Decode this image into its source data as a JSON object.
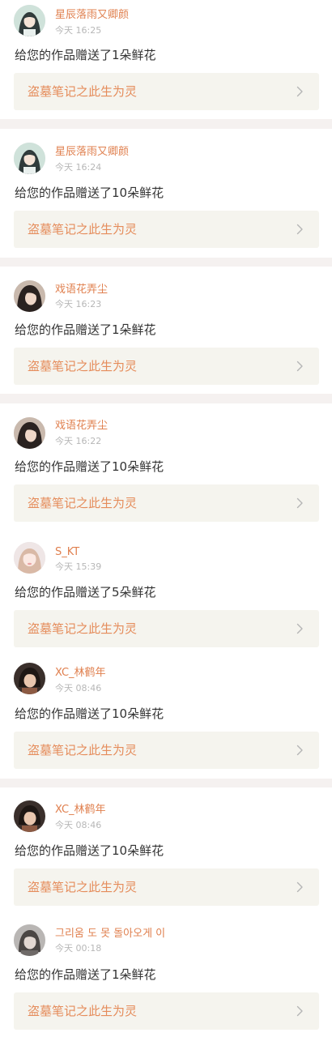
{
  "colors": {
    "name": "#e0804f",
    "time": "#b7b7b7",
    "message": "#333333",
    "card_bg": "#f5f4ee",
    "card_title": "#e58c5b",
    "separator": "#f5f1f0"
  },
  "items": [
    {
      "avatar": "avatar-anime-girl-icon",
      "name": "星辰落雨又卿颜",
      "time": "今天 16:25",
      "message": "给您的作品赠送了1朵鲜花",
      "work_title": "盗墓笔记之此生为灵",
      "arrow": "chevron-right-icon"
    },
    {
      "avatar": "avatar-anime-girl-icon",
      "name": "星辰落雨又卿颜",
      "time": "今天 16:24",
      "message": "给您的作品赠送了10朵鲜花",
      "work_title": "盗墓笔记之此生为灵",
      "arrow": "chevron-right-icon"
    },
    {
      "avatar": "avatar-dark-hair-icon",
      "name": "戏语花弄尘",
      "time": "今天 16:23",
      "message": "给您的作品赠送了1朵鲜花",
      "work_title": "盗墓笔记之此生为灵",
      "arrow": "chevron-right-icon"
    },
    {
      "avatar": "avatar-dark-hair-icon",
      "name": "戏语花弄尘",
      "time": "今天 16:22",
      "message": "给您的作品赠送了10朵鲜花",
      "work_title": "盗墓笔记之此生为灵",
      "arrow": "chevron-right-icon"
    },
    {
      "avatar": "avatar-light-girl-icon",
      "name": "S_KT",
      "time": "今天 15:39",
      "message": "给您的作品赠送了5朵鲜花",
      "work_title": "盗墓笔记之此生为灵",
      "arrow": "chevron-right-icon"
    },
    {
      "avatar": "avatar-boy-photo-icon",
      "name": "XC_林鹤年",
      "time": "今天 08:46",
      "message": "给您的作品赠送了10朵鲜花",
      "work_title": "盗墓笔记之此生为灵",
      "arrow": "chevron-right-icon"
    },
    {
      "avatar": "avatar-boy-photo-icon",
      "name": "XC_林鹤年",
      "time": "今天 08:46",
      "message": "给您的作品赠送了10朵鲜花",
      "work_title": "盗墓笔记之此生为灵",
      "arrow": "chevron-right-icon"
    },
    {
      "avatar": "avatar-gray-boy-icon",
      "name": "그리움 도 못 돌아오게 이",
      "time": "今天 00:18",
      "message": "给您的作品赠送了1朵鲜花",
      "work_title": "盗墓笔记之此生为灵",
      "arrow": "chevron-right-icon"
    }
  ]
}
